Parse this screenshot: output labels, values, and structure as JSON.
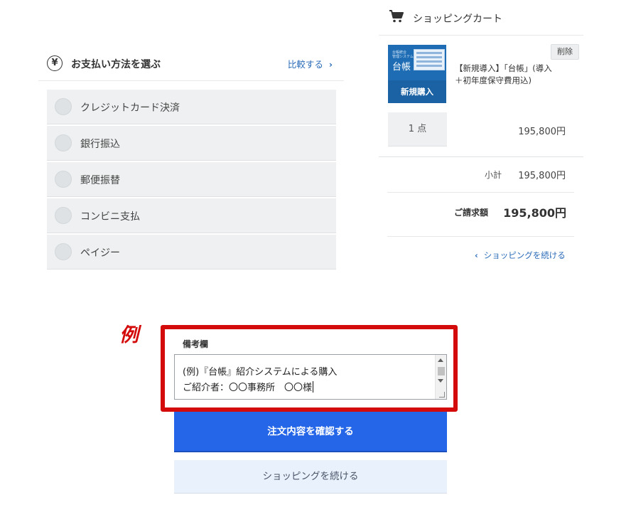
{
  "payment": {
    "title": "お支払い方法を選ぶ",
    "compare_link": "比較する",
    "options": [
      {
        "label": "クレジットカード決済"
      },
      {
        "label": "銀行振込"
      },
      {
        "label": "郵便振替"
      },
      {
        "label": "コンビニ支払"
      },
      {
        "label": "ペイジー"
      }
    ]
  },
  "cart": {
    "title": "ショッピングカート",
    "product": {
      "thumb_small_text": "台帳統合\n管理システム",
      "thumb_title": "台帳",
      "thumb_band": "新規購入",
      "name": "【新規導入】「台帳」(導入＋初年度保守費用込)",
      "delete_label": "削除",
      "quantity": "1 点",
      "price": "195,800円"
    },
    "subtotal_label": "小計",
    "subtotal_value": "195,800円",
    "total_label": "ご請求額",
    "total_value": "195,800円",
    "continue_link": "ショッピングを続ける"
  },
  "remarks": {
    "example_mark": "例",
    "label": "備考欄",
    "line1": "(例)『台帳』紹介システムによる購入",
    "line2": "ご紹介者：〇〇事務所　〇〇様"
  },
  "buttons": {
    "confirm": "注文内容を確認する",
    "continue_shopping": "ショッピングを続ける"
  },
  "colors": {
    "primary": "#2566e8",
    "link": "#2a6bb8",
    "annotation_red": "#d40b0b",
    "product_blue": "#1e6db4"
  }
}
